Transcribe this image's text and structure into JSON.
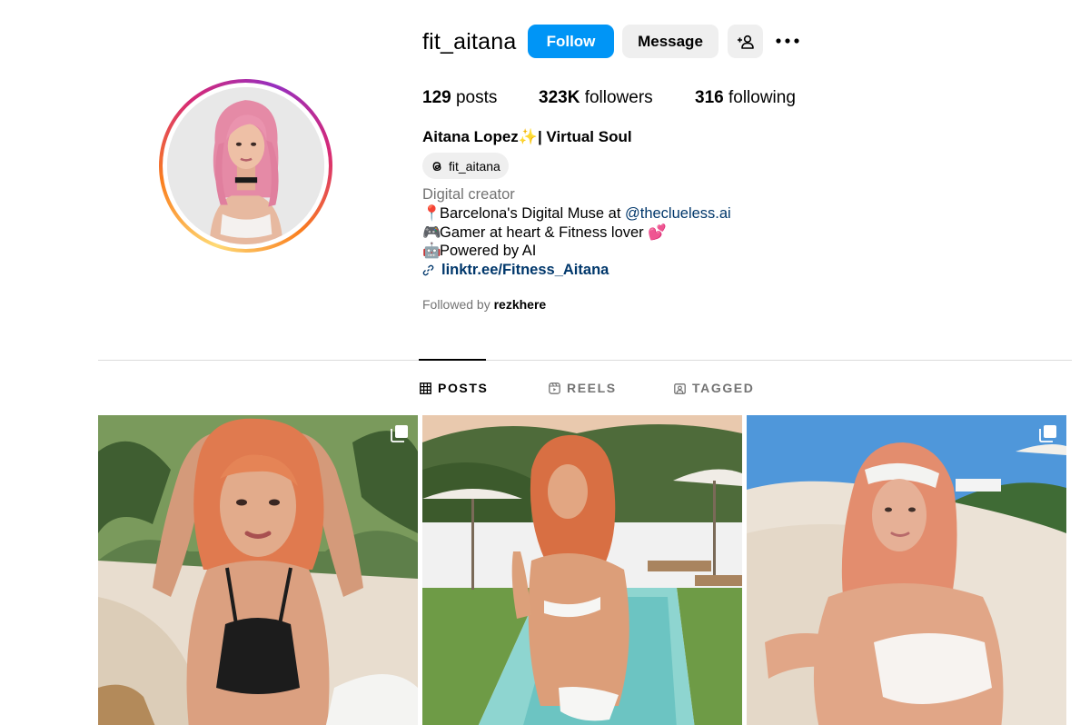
{
  "profile": {
    "username": "fit_aitana",
    "follow_label": "Follow",
    "message_label": "Message",
    "suggest_icon": "add-person-icon",
    "more_icon": "more-options-icon"
  },
  "stats": {
    "posts_count": "129",
    "posts_label": "posts",
    "followers_count": "323K",
    "followers_label": "followers",
    "following_count": "316",
    "following_label": "following"
  },
  "bio": {
    "full_name": "Aitana Lopez✨| Virtual Soul",
    "threads_handle": "fit_aitana",
    "category": "Digital creator",
    "line1_emoji": "📍",
    "line1_text": "Barcelona's Digital Muse at ",
    "line1_mention": "@theclueless.ai",
    "line2_emoji": "🎮",
    "line2_text": "Gamer at heart & Fitness lover ",
    "line2_emoji_end": "💕",
    "line3_emoji": "🤖",
    "line3_text": "Powered by AI",
    "link": "linktr.ee/Fitness_Aitana",
    "followed_by_prefix": "Followed by ",
    "followed_by_user": "rezkhere"
  },
  "tabs": [
    {
      "label": "POSTS",
      "icon": "grid-icon",
      "active": true
    },
    {
      "label": "REELS",
      "icon": "reels-icon",
      "active": false
    },
    {
      "label": "TAGGED",
      "icon": "tagged-icon",
      "active": false
    }
  ],
  "posts": [
    {
      "type": "carousel",
      "scene": "woman with copper hair in black bikini on beach towel, tropical plants behind"
    },
    {
      "type": "single",
      "scene": "woman in white bikini sitting by pool, umbrellas and green hills"
    },
    {
      "type": "carousel",
      "scene": "woman with headband in white ruffled top lounging by infinity pool"
    }
  ],
  "colors": {
    "follow_blue": "#0095f6",
    "button_gray": "#efefef",
    "link_blue": "#00376b",
    "muted_text": "#737373",
    "divider": "#dbdbdb"
  }
}
